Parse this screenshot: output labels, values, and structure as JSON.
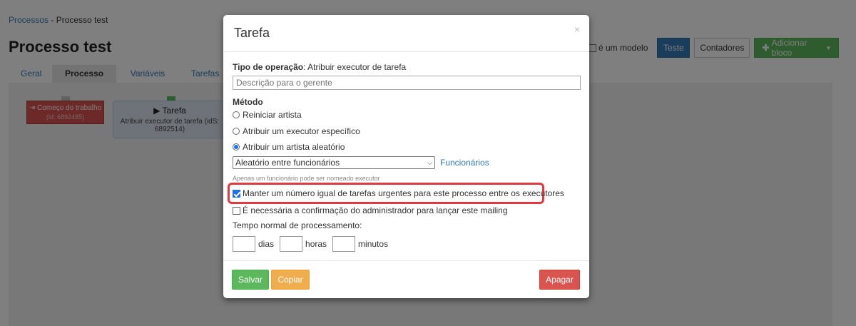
{
  "breadcrumb": {
    "root": "Processos",
    "separator": " - ",
    "current": "Processo test"
  },
  "page": {
    "title": "Processo test"
  },
  "tabs": [
    "Geral",
    "Processo",
    "Variáveis",
    "Tarefas"
  ],
  "toolbar": {
    "model_label": "é um modelo",
    "test_label": "Teste",
    "counters_label": "Contadores",
    "add_block_label": "Adicionar bloco",
    "add_icon": "plus-icon",
    "caret_icon": "caret-down-icon"
  },
  "blocks": {
    "start_title": "Começo do trabalho",
    "start_sub": "(id: 6892485)",
    "task_title": "Tarefa",
    "task_desc": "Atribuir executor de tarefa (idS: 6892514)"
  },
  "modal": {
    "title": "Tarefa",
    "close_icon": "close-icon",
    "operation_label": "Tipo de operação",
    "operation_value": "Atribuir executor de tarefa",
    "description_placeholder": "Descrição para o gerente",
    "method_label": "Método",
    "radios": [
      "Reiniciar artista",
      "Atribuir um executor específico",
      "Atribuir um artista aleatório"
    ],
    "random_select": "Aleatório entre funcionários",
    "employees_link": "Funcionários",
    "hint": "Apenas um funcionário pode ser nomeado executor",
    "checkbox_equal": "Manter um número igual de tarefas urgentes para este processo entre os executores",
    "checkbox_admin": "É necessária a confirmação do administrador para lançar este mailing",
    "time_label": "Tempo normal de processamento:",
    "unit_days": "dias",
    "unit_hours": "horas",
    "unit_minutes": "minutos",
    "save_label": "Salvar",
    "copy_label": "Copiar",
    "delete_label": "Apagar"
  },
  "colors": {
    "primary": "#337ab7",
    "success": "#5cb85c",
    "warning": "#f0ad4e",
    "danger": "#d9534f",
    "highlight": "#e0393e"
  }
}
